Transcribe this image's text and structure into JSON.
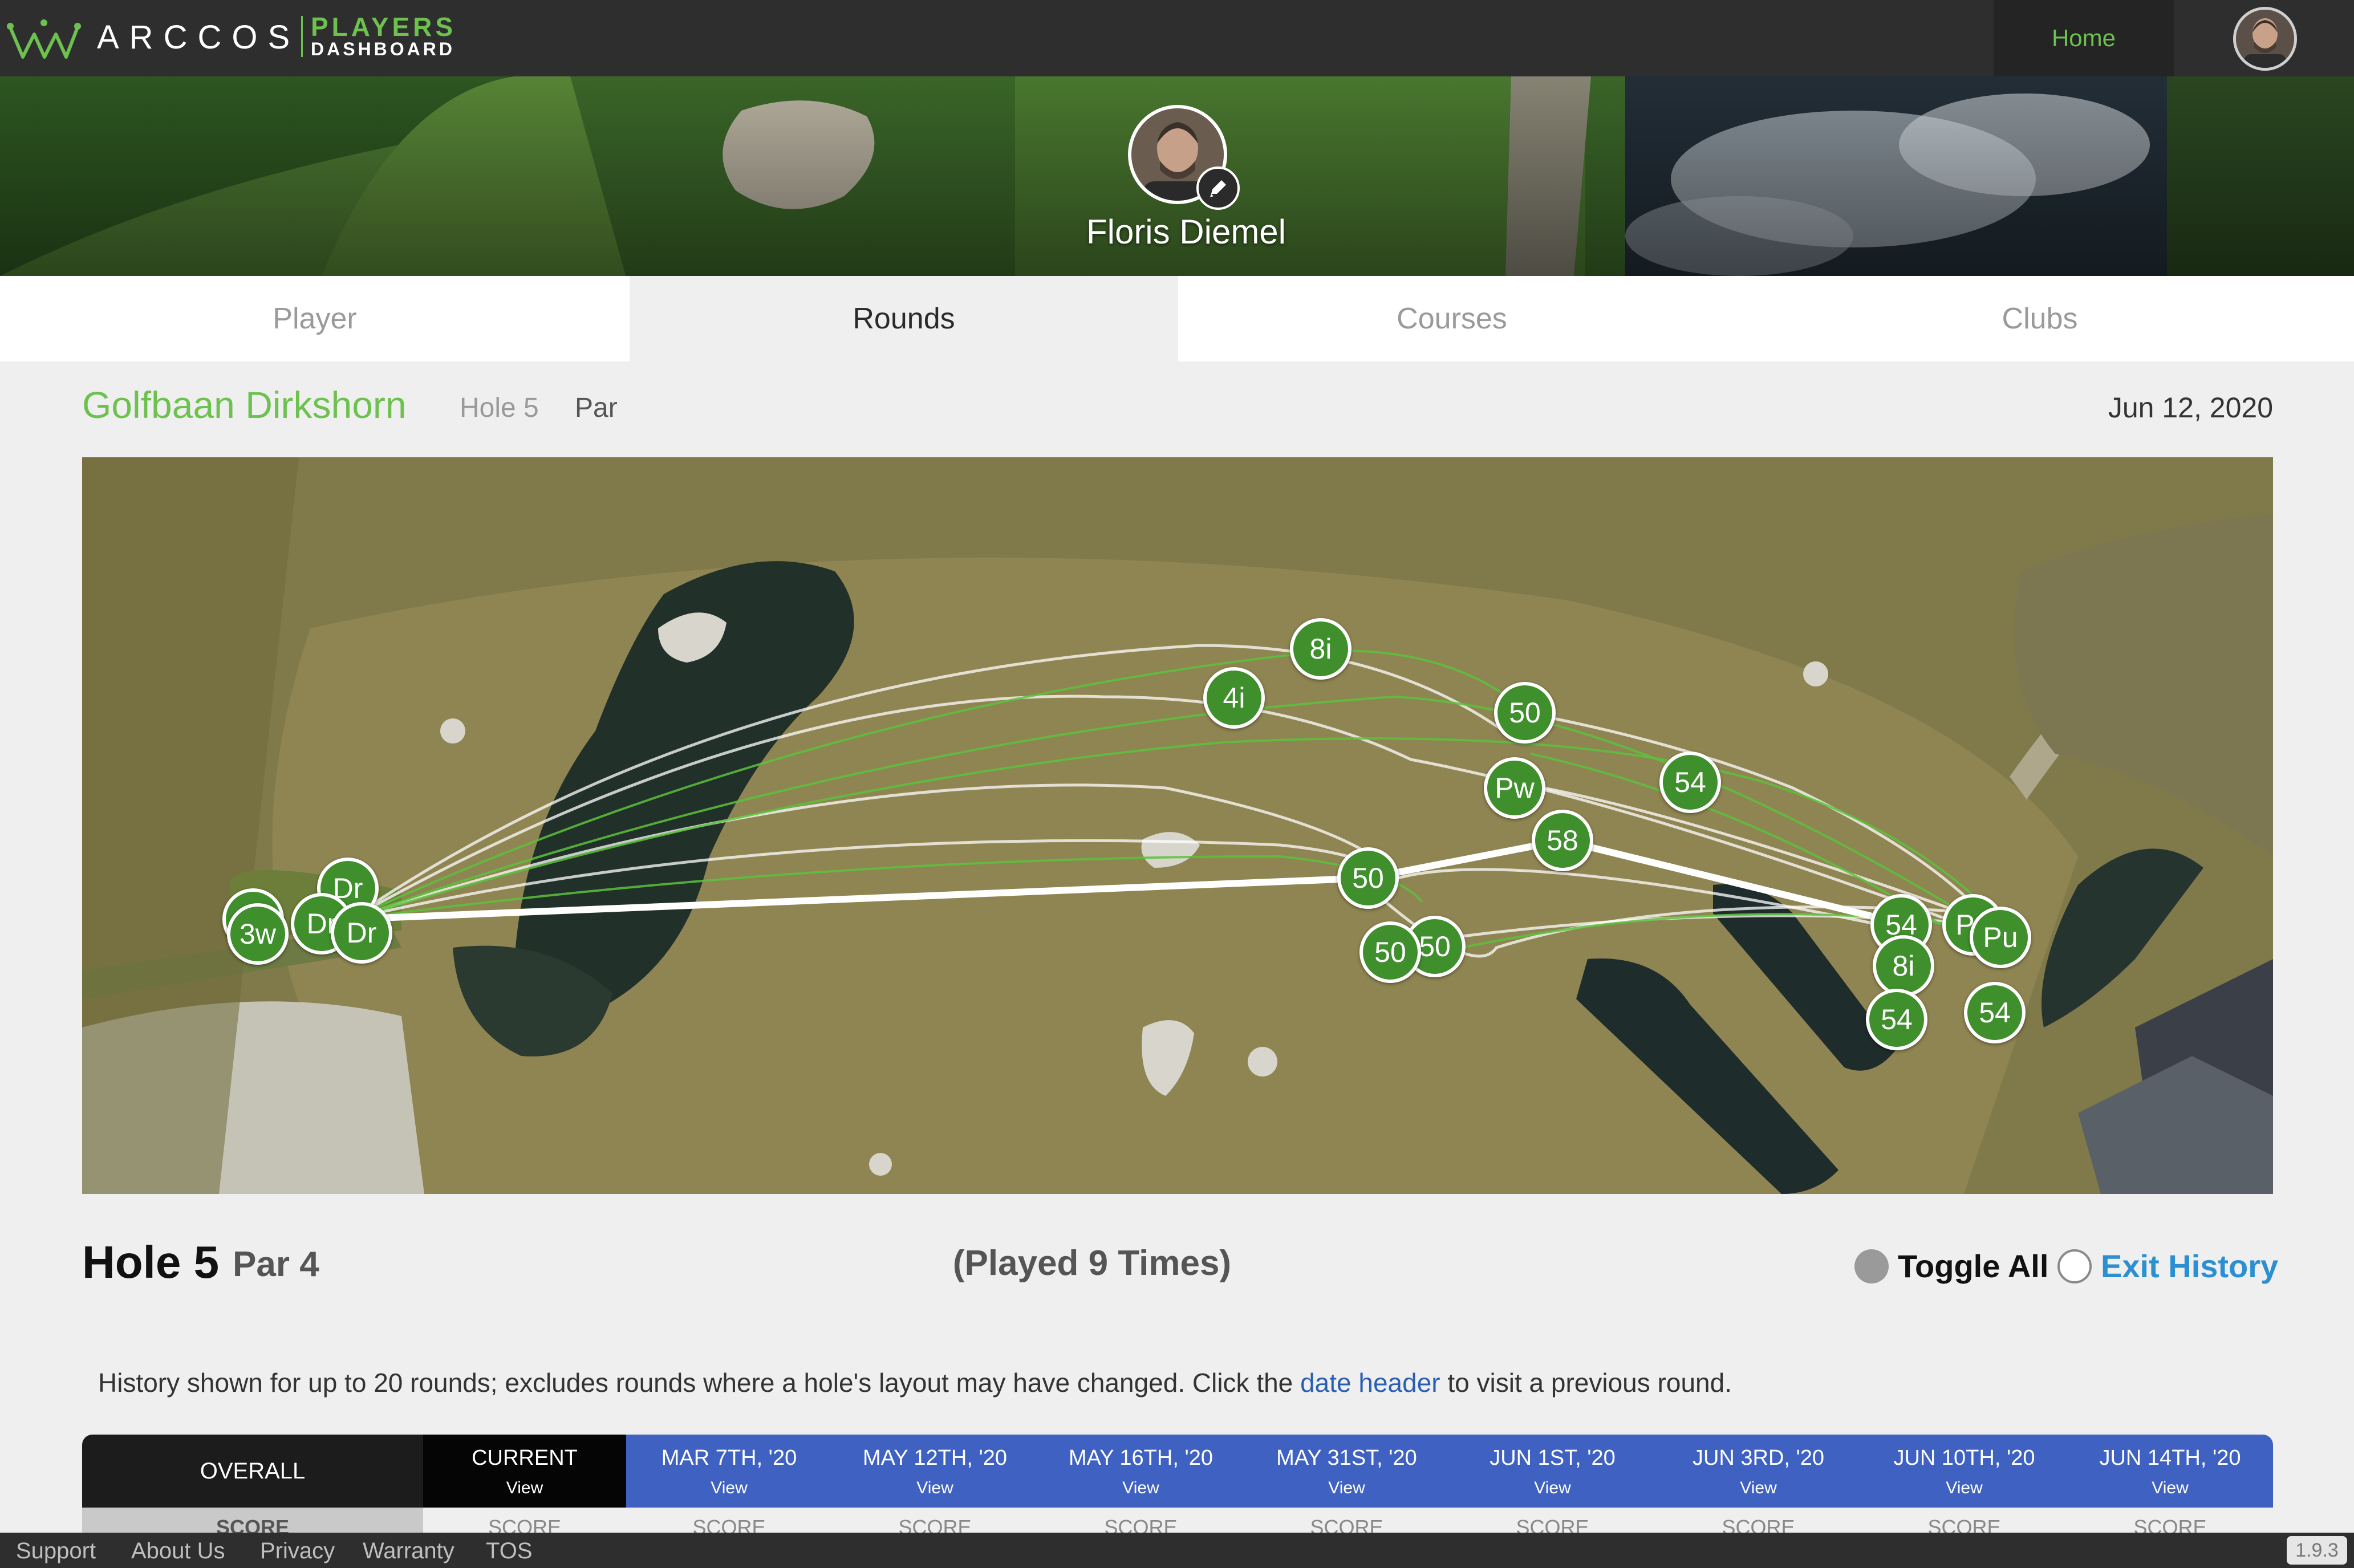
{
  "brand": {
    "name": "ARCCOS",
    "product_top": "PLAYERS",
    "product_bottom": "DASHBOARD"
  },
  "nav": {
    "home": "Home"
  },
  "profile": {
    "name": "Floris Diemel"
  },
  "tabs": [
    {
      "label": "Player",
      "active": false
    },
    {
      "label": "Rounds",
      "active": true
    },
    {
      "label": "Courses",
      "active": false
    },
    {
      "label": "Clubs",
      "active": false
    }
  ],
  "course": {
    "name": "Golfbaan Dirkshorn",
    "hole": "Hole 5",
    "par": "Par",
    "date": "Jun 12, 2020"
  },
  "map": {
    "shot_markers": [
      "8i",
      "4i",
      "50",
      "Pw",
      "54",
      "58",
      "50",
      "50",
      "50",
      "54",
      "8i",
      "54",
      "Pu",
      "Pu",
      "54",
      "Dr",
      "Dr",
      "Dr",
      "3w",
      "3w"
    ]
  },
  "summary": {
    "hole": "Hole 5",
    "par": "Par 4",
    "played": "(Played 9 Times)",
    "toggle_all": "Toggle All",
    "exit_history": "Exit History"
  },
  "history_note": {
    "before": "History shown for up to 20 rounds; excludes rounds where a hole's layout may have changed. Click the ",
    "link": "date header",
    "after": " to visit a previous round."
  },
  "history_table": {
    "overall": "OVERALL",
    "current": {
      "label": "CURRENT",
      "view": "View"
    },
    "rounds": [
      {
        "date": "MAR 7TH, '20",
        "view": "View"
      },
      {
        "date": "MAY 12TH, '20",
        "view": "View"
      },
      {
        "date": "MAY 16TH, '20",
        "view": "View"
      },
      {
        "date": "MAY 31ST, '20",
        "view": "View"
      },
      {
        "date": "JUN 1ST, '20",
        "view": "View"
      },
      {
        "date": "JUN 3RD, '20",
        "view": "View"
      },
      {
        "date": "JUN 10TH, '20",
        "view": "View"
      },
      {
        "date": "JUN 14TH, '20",
        "view": "View"
      }
    ],
    "score_label": "SCORE"
  },
  "footer": {
    "links": [
      "Support",
      "About Us",
      "Privacy",
      "Warranty",
      "TOS"
    ],
    "version": "1.9.3"
  },
  "colors": {
    "accent_green": "#6dc14f",
    "marker_green": "#3f8f2c",
    "history_blue": "#3f62c2",
    "link_blue": "#2b8fd1"
  }
}
